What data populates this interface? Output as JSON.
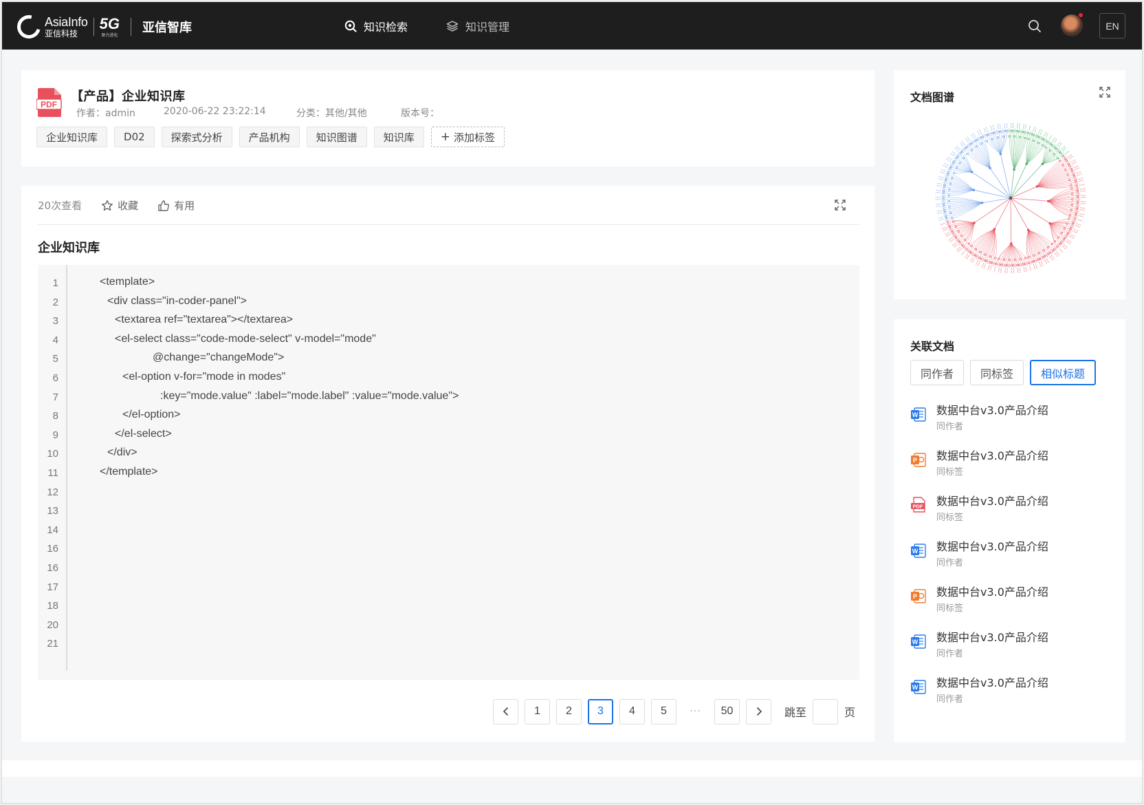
{
  "topbar": {
    "logo_en": "AsiaInfo",
    "logo_cn": "亚信科技",
    "logo_5g": "5G",
    "logo_5g_sub": "原力进化",
    "app_title": "亚信智库",
    "nav": [
      {
        "label": "知识检索",
        "icon": "search-doc-icon",
        "active": true
      },
      {
        "label": "知识管理",
        "icon": "layers-icon",
        "active": false
      }
    ],
    "lang": "EN"
  },
  "document": {
    "title": "【产品】企业知识库",
    "author": "作者：admin",
    "date": "2020-06-22 23:22:14",
    "category": "分类：其他/其他",
    "version": "版本号：",
    "tags": [
      "企业知识库",
      "D02",
      "探索式分析",
      "产品机构",
      "知识图谱",
      "知识库"
    ],
    "add_tag": "添加标签"
  },
  "content": {
    "views": "20次查看",
    "favorite": "收藏",
    "useful": "有用",
    "section_title": "企业知识库",
    "line_numbers": [
      "1",
      "2",
      "3",
      "4",
      "5",
      "6",
      "7",
      "8",
      "9",
      "10",
      "11",
      "12",
      "13",
      "14",
      "16",
      "16",
      "17",
      "18",
      "20",
      "21"
    ],
    "code_lines": [
      {
        "indent": 0,
        "text": "<template>"
      },
      {
        "indent": 1,
        "text": "<div class=\"in-coder-panel\">"
      },
      {
        "indent": 2,
        "text": "<textarea ref=\"textarea\"></textarea>"
      },
      {
        "indent": 2,
        "text": "<el-select class=\"code-mode-select\" v-model=\"mode\""
      },
      {
        "indent": 7,
        "text": "@change=\"changeMode\">"
      },
      {
        "indent": 3,
        "text": "<el-option v-for=\"mode in modes\""
      },
      {
        "indent": 8,
        "text": ":key=\"mode.value\" :label=\"mode.label\" :value=\"mode.value\">"
      },
      {
        "indent": 3,
        "text": "</el-option>"
      },
      {
        "indent": 2,
        "text": "</el-select>"
      },
      {
        "indent": 1,
        "text": "</div>"
      },
      {
        "indent": 0,
        "text": "</template>"
      }
    ]
  },
  "pagination": {
    "pages": [
      "1",
      "2",
      "3",
      "4",
      "5"
    ],
    "current": "3",
    "ellipsis": "···",
    "last": "50",
    "jump_label": "跳至",
    "page_label": "页"
  },
  "graph": {
    "title": "文档图谱",
    "colors": {
      "blue": "#6a9bea",
      "green": "#4caf6a",
      "red": "#e8505b"
    }
  },
  "related": {
    "title": "关联文档",
    "filters": [
      "同作者",
      "同标签",
      "相似标题"
    ],
    "active_filter": "相似标题",
    "items": [
      {
        "type": "word-icon",
        "title": "数据中台v3.0产品介绍",
        "relation": "同作者"
      },
      {
        "type": "ppt-icon",
        "title": "数据中台v3.0产品介绍",
        "relation": "同标签"
      },
      {
        "type": "pdf-icon",
        "title": "数据中台v3.0产品介绍",
        "relation": "同标签"
      },
      {
        "type": "word-icon",
        "title": "数据中台v3.0产品介绍",
        "relation": "同作者"
      },
      {
        "type": "ppt-icon",
        "title": "数据中台v3.0产品介绍",
        "relation": "同标签"
      },
      {
        "type": "word-icon",
        "title": "数据中台v3.0产品介绍",
        "relation": "同作者"
      },
      {
        "type": "word-icon",
        "title": "数据中台v3.0产品介绍",
        "relation": "同作者"
      }
    ]
  }
}
